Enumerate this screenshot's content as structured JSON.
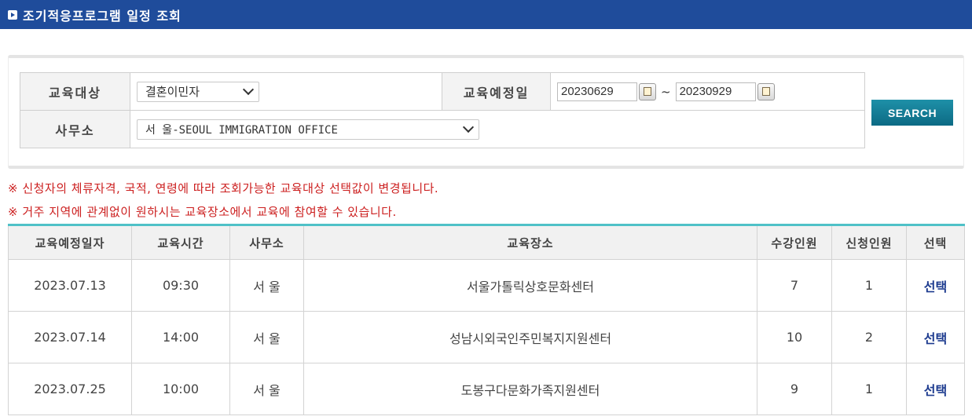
{
  "header": {
    "title": "조기적응프로그램 일정 조회"
  },
  "search": {
    "target_label": "교육대상",
    "target_value": "결혼이민자",
    "date_label": "교육예정일",
    "date_from": "20230629",
    "date_separator": "~",
    "date_to": "20230929",
    "office_label": "사무소",
    "office_value": "서 울-SEOUL IMMIGRATION OFFICE",
    "search_button": "SEARCH"
  },
  "notes": [
    "※ 신청자의 체류자격, 국적, 연령에 따라 조회가능한 교육대상 선택값이 변경됩니다.",
    "※ 거주 지역에 관계없이 원하시는 교육장소에서 교육에 참여할 수 있습니다."
  ],
  "table": {
    "columns": [
      "교육예정일자",
      "교육시간",
      "사무소",
      "교육장소",
      "수강인원",
      "신청인원",
      "선택"
    ],
    "rows": [
      {
        "date": "2023.07.13",
        "time": "09:30",
        "office": "서 울",
        "place": "서울가톨릭상호문화센터",
        "capacity": "7",
        "applied": "1",
        "select": "선택"
      },
      {
        "date": "2023.07.14",
        "time": "14:00",
        "office": "서 울",
        "place": "성남시외국인주민복지지원센터",
        "capacity": "10",
        "applied": "2",
        "select": "선택"
      },
      {
        "date": "2023.07.25",
        "time": "10:00",
        "office": "서 울",
        "place": "도봉구다문화가족지원센터",
        "capacity": "9",
        "applied": "1",
        "select": "선택"
      }
    ]
  },
  "colors": {
    "header_bg": "#1f4c9b",
    "notice_text": "#cc1f1f",
    "table_top_border": "#4fc1c7",
    "button_bg": "#0c6a84"
  }
}
